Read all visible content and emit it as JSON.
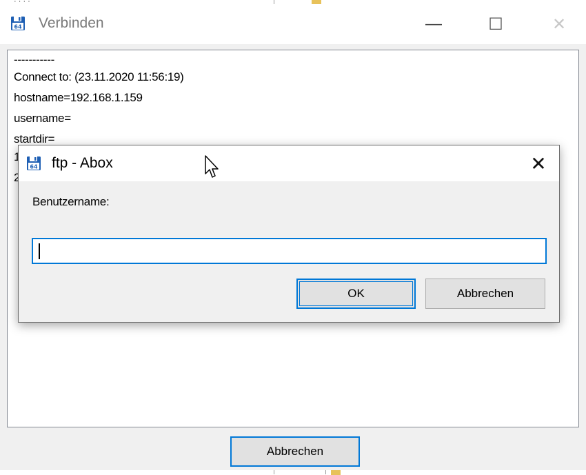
{
  "main_window": {
    "title": "Verbinden",
    "controls": {
      "minimize": "—",
      "maximize": "☐",
      "close": "✕"
    },
    "log_lines": [
      "-----------",
      "Connect to: (23.11.2020 11:56:19)",
      "hostname=192.168.1.159",
      "username=",
      "startdir=",
      "1",
      "2"
    ],
    "cancel_label": "Abbrechen"
  },
  "dialog": {
    "title": "ftp - Abox",
    "close": "✕",
    "prompt_label": "Benutzername:",
    "input_value": "",
    "ok_label": "OK",
    "cancel_label": "Abbrechen"
  },
  "icons": {
    "app": "floppy-disk-64-icon",
    "cursor": "mouse-pointer-icon"
  },
  "colors": {
    "accent": "#0078d7",
    "window_bg": "#f0f0f0",
    "title_text_inactive": "#7a7a7a",
    "icon_blue": "#1e5fb4"
  }
}
